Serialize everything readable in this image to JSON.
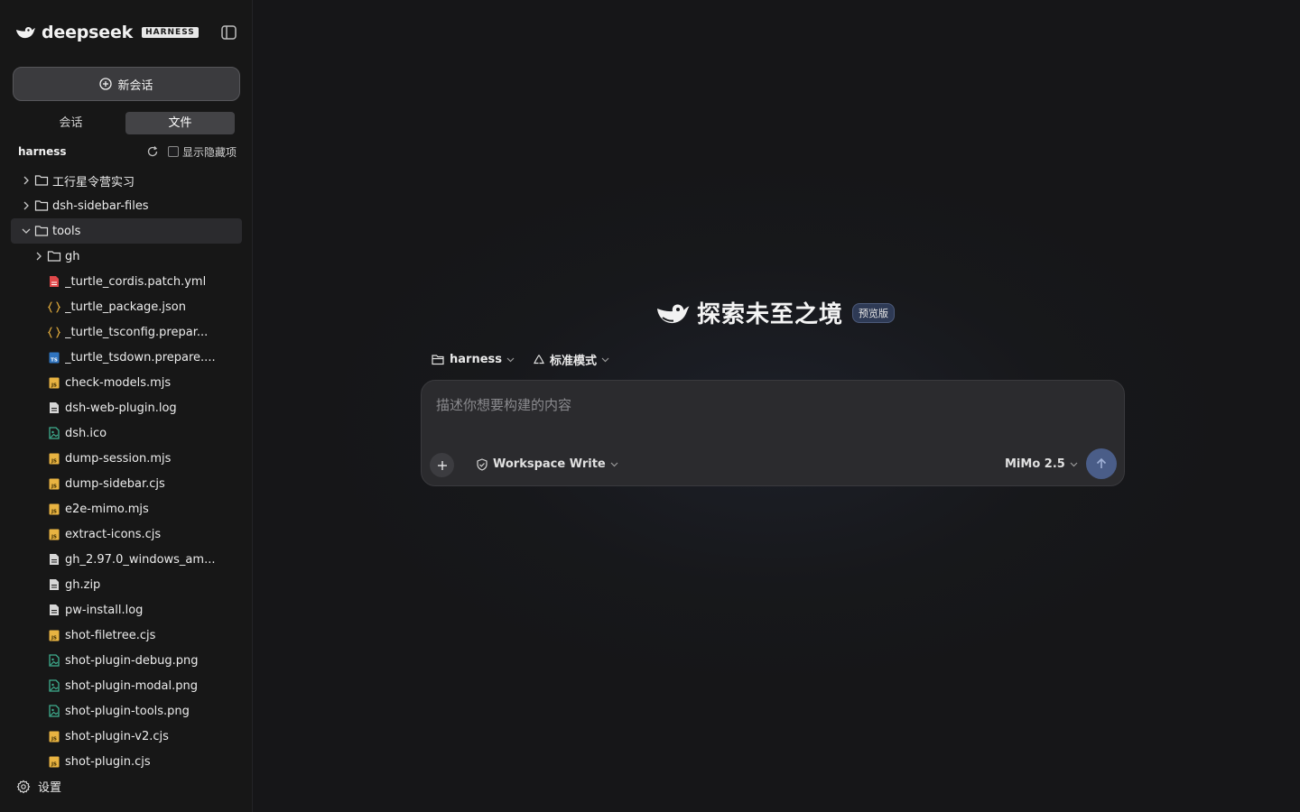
{
  "brand": {
    "name": "deepseek",
    "badge": "HARNESS"
  },
  "sidebar": {
    "new_chat_label": "新会话",
    "tabs": [
      {
        "label": "会话",
        "active": false
      },
      {
        "label": "文件",
        "active": true
      }
    ],
    "tree_root": "harness",
    "show_hidden_label": "显示隐藏项",
    "settings_label": "设置"
  },
  "file_tree": [
    {
      "name": "工行星令营实习",
      "type": "folder",
      "depth": 0,
      "expanded": false
    },
    {
      "name": "dsh-sidebar-files",
      "type": "folder",
      "depth": 0,
      "expanded": false
    },
    {
      "name": "tools",
      "type": "folder",
      "depth": 0,
      "expanded": true,
      "selected": true
    },
    {
      "name": "gh",
      "type": "folder",
      "depth": 1,
      "expanded": false
    },
    {
      "name": "_turtle_cordis.patch.yml",
      "type": "yml",
      "depth": 1
    },
    {
      "name": "_turtle_package.json",
      "type": "json",
      "depth": 1
    },
    {
      "name": "_turtle_tsconfig.prepar...",
      "type": "json",
      "depth": 1
    },
    {
      "name": "_turtle_tsdown.prepare....",
      "type": "ts",
      "depth": 1
    },
    {
      "name": "check-models.mjs",
      "type": "js",
      "depth": 1
    },
    {
      "name": "dsh-web-plugin.log",
      "type": "file",
      "depth": 1
    },
    {
      "name": "dsh.ico",
      "type": "image",
      "depth": 1
    },
    {
      "name": "dump-session.mjs",
      "type": "js",
      "depth": 1
    },
    {
      "name": "dump-sidebar.cjs",
      "type": "js",
      "depth": 1
    },
    {
      "name": "e2e-mimo.mjs",
      "type": "js",
      "depth": 1
    },
    {
      "name": "extract-icons.cjs",
      "type": "js",
      "depth": 1
    },
    {
      "name": "gh_2.97.0_windows_am...",
      "type": "file",
      "depth": 1
    },
    {
      "name": "gh.zip",
      "type": "file",
      "depth": 1
    },
    {
      "name": "pw-install.log",
      "type": "file",
      "depth": 1
    },
    {
      "name": "shot-filetree.cjs",
      "type": "js",
      "depth": 1
    },
    {
      "name": "shot-plugin-debug.png",
      "type": "image",
      "depth": 1
    },
    {
      "name": "shot-plugin-modal.png",
      "type": "image",
      "depth": 1
    },
    {
      "name": "shot-plugin-tools.png",
      "type": "image",
      "depth": 1
    },
    {
      "name": "shot-plugin-v2.cjs",
      "type": "js",
      "depth": 1
    },
    {
      "name": "shot-plugin.cjs",
      "type": "js",
      "depth": 1
    }
  ],
  "hero": {
    "title": "探索未至之境",
    "badge": "预览版"
  },
  "composer": {
    "workspace": "harness",
    "mode": "标准模式",
    "placeholder": "描述你想要构建的内容",
    "permission": "Workspace Write",
    "model": "MiMo 2.5"
  },
  "colors": {
    "accent": "#4a5d88",
    "js_icon": "#e8b341",
    "json_icon": "#d9a53a",
    "yml_icon": "#e0484a",
    "ts_icon": "#2f74c0",
    "image_icon": "#3fae8f",
    "file_icon": "#d6d6d6"
  }
}
